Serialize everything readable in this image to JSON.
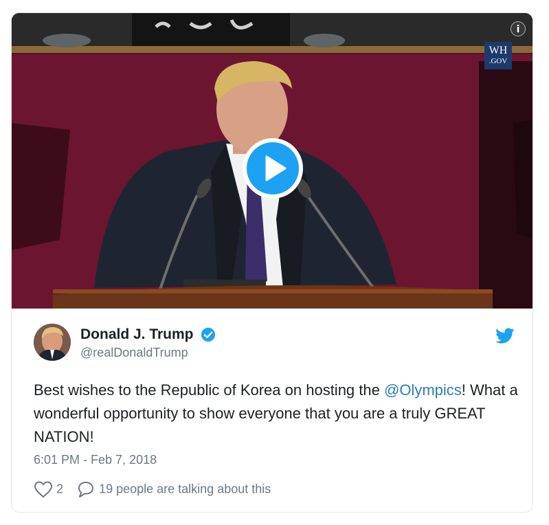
{
  "video": {
    "info_icon_glyph": "i",
    "badge_line1": "WH",
    "badge_line2": ".GOV",
    "background_color": "#3a0f1a",
    "play_color": "#1da1f2"
  },
  "author": {
    "display_name": "Donald J. Trump",
    "handle": "@realDonaldTrump",
    "verified": true
  },
  "tweet": {
    "text_before": "Best wishes to the Republic of Korea on hosting the ",
    "mention": "@Olympics",
    "text_after": "! What a wonderful opportunity to show everyone that you are a truly GREAT NATION!",
    "timestamp": "6:01 PM - Feb 7, 2018"
  },
  "actions": {
    "like_count": "2",
    "conversation_text": "19 people are talking about this"
  },
  "icons": [
    "info-icon",
    "play-icon",
    "verified-icon",
    "twitter-bird-icon",
    "heart-icon",
    "reply-bubble-icon"
  ],
  "colors": {
    "accent": "#1da1f2",
    "link": "#2b7bb9",
    "muted": "#697882",
    "text": "#1c2022"
  }
}
